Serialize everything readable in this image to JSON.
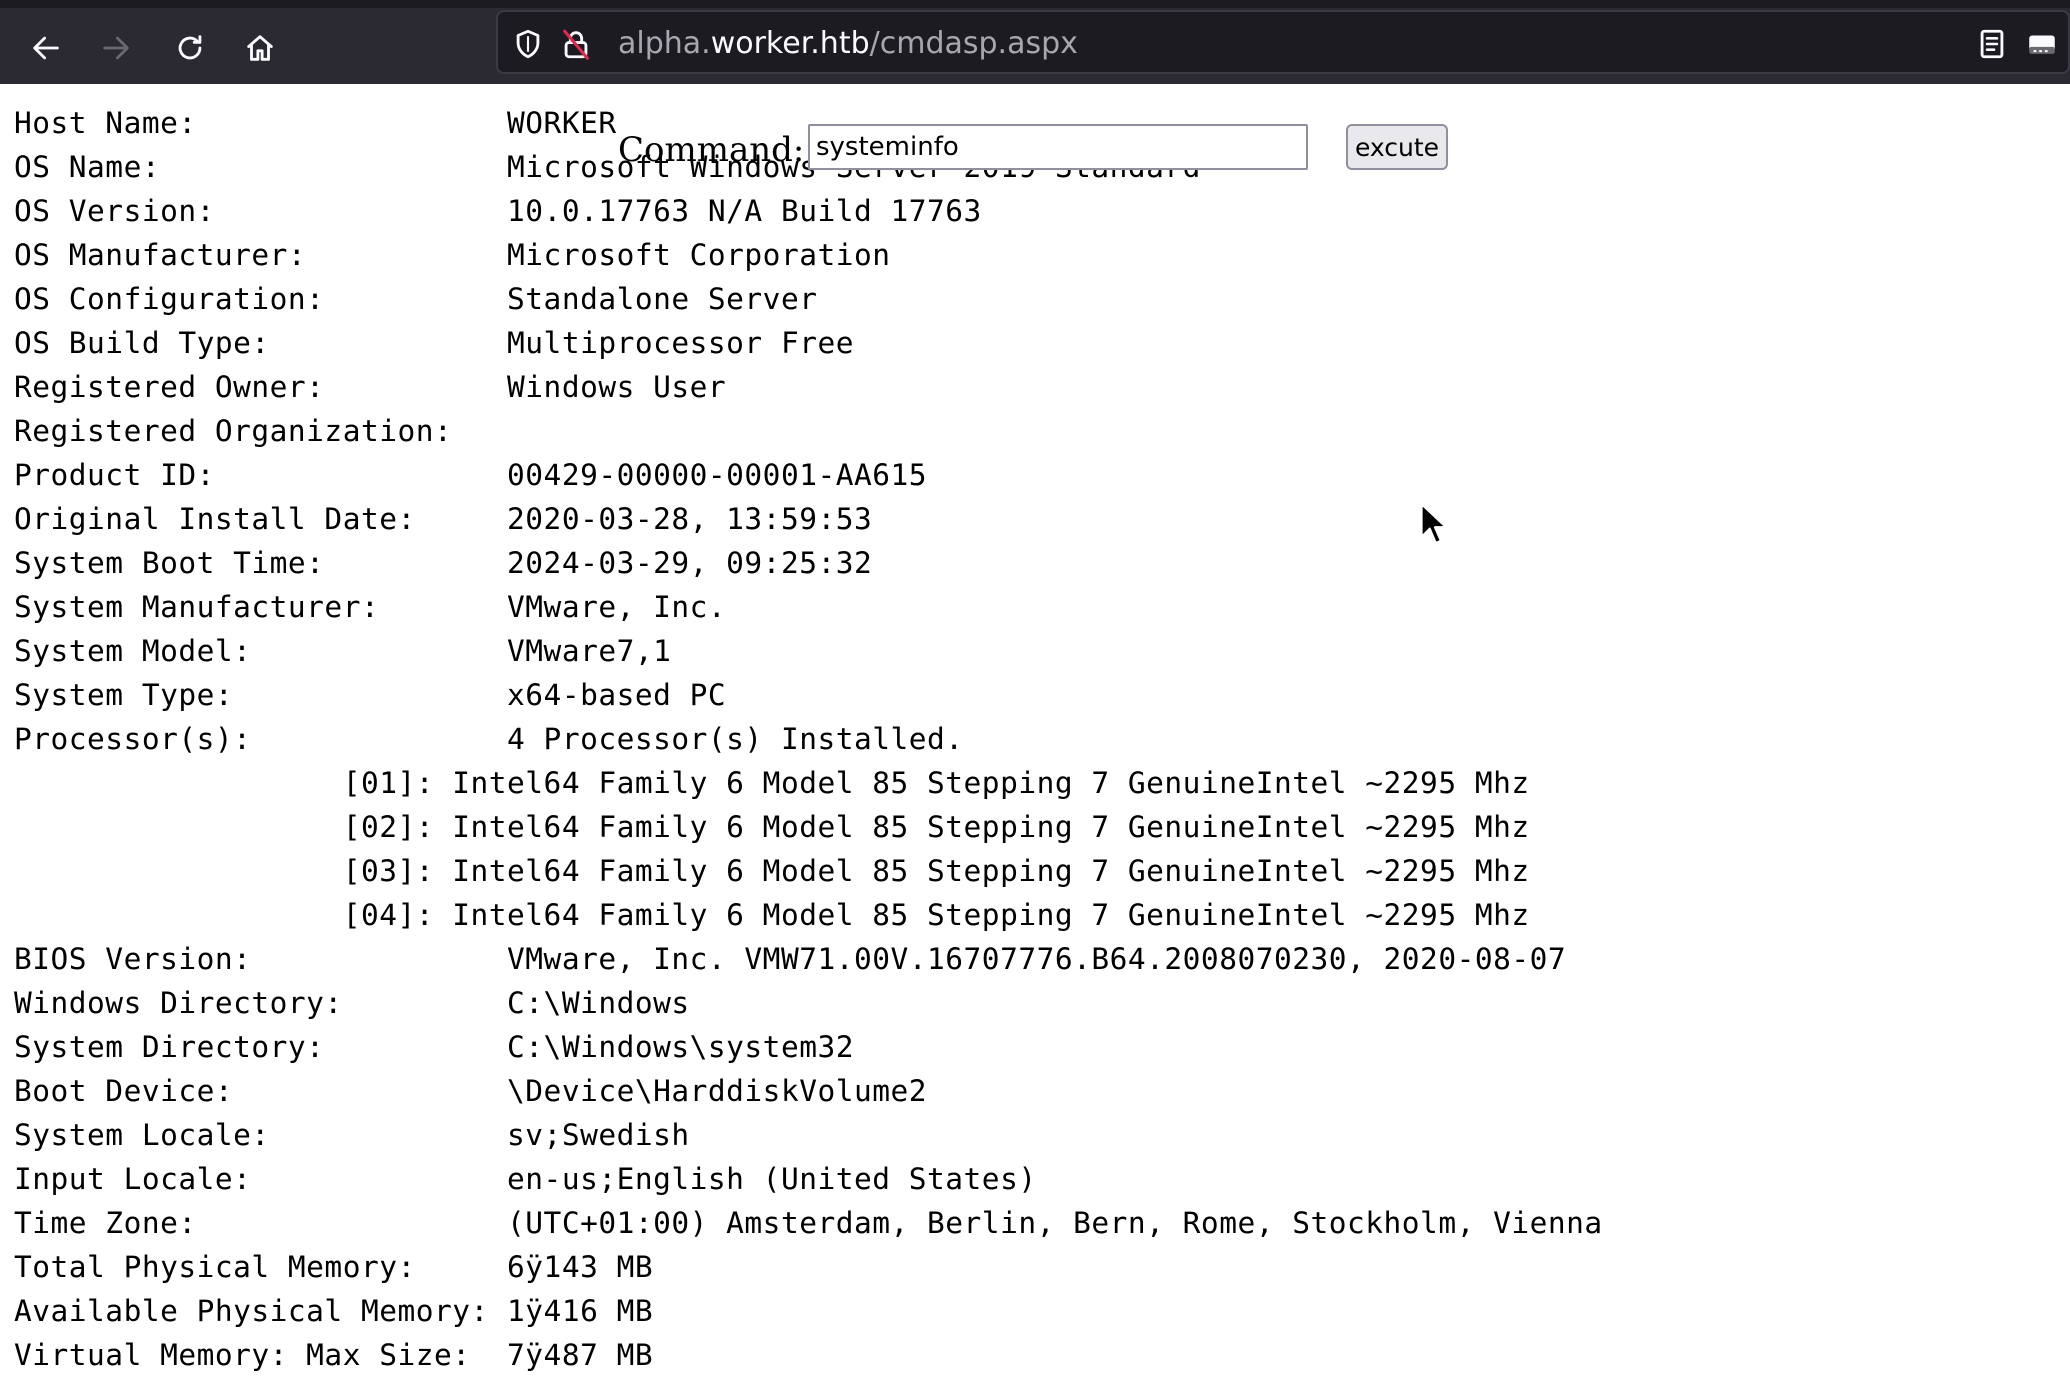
{
  "browser": {
    "url_prefix": "alpha.",
    "url_host": "worker.htb",
    "url_path": "/cmdasp.aspx",
    "icons": {
      "back": "arrow-left-icon",
      "forward": "arrow-right-icon",
      "reload": "reload-icon",
      "home": "home-icon",
      "tracking": "shield-icon",
      "insecure": "insecure-lock-icon",
      "reader": "reader-view-icon",
      "extension": "extension-icon"
    },
    "colors": {
      "toolbar": "#2b2a33",
      "urlbar": "#1c1b22",
      "icon": "#fbfbfe",
      "icon_disabled": "#6a6970",
      "insecure_accent": "#e22850"
    }
  },
  "form": {
    "label": "Command:",
    "input_value": "systeminfo",
    "button_label": "excute"
  },
  "output_lines": [
    "Host Name:                 WORKER",
    "OS Name:                   Microsoft Windows Server 2019 Standard",
    "OS Version:                10.0.17763 N/A Build 17763",
    "OS Manufacturer:           Microsoft Corporation",
    "OS Configuration:          Standalone Server",
    "OS Build Type:             Multiprocessor Free",
    "Registered Owner:          Windows User",
    "Registered Organization:",
    "Product ID:                00429-00000-00001-AA615",
    "Original Install Date:     2020-03-28, 13:59:53",
    "System Boot Time:          2024-03-29, 09:25:32",
    "System Manufacturer:       VMware, Inc.",
    "System Model:              VMware7,1",
    "System Type:               x64-based PC",
    "Processor(s):              4 Processor(s) Installed.",
    "                  [01]: Intel64 Family 6 Model 85 Stepping 7 GenuineIntel ~2295 Mhz",
    "                  [02]: Intel64 Family 6 Model 85 Stepping 7 GenuineIntel ~2295 Mhz",
    "                  [03]: Intel64 Family 6 Model 85 Stepping 7 GenuineIntel ~2295 Mhz",
    "                  [04]: Intel64 Family 6 Model 85 Stepping 7 GenuineIntel ~2295 Mhz",
    "BIOS Version:              VMware, Inc. VMW71.00V.16707776.B64.2008070230, 2020-08-07",
    "Windows Directory:         C:\\Windows",
    "System Directory:          C:\\Windows\\system32",
    "Boot Device:               \\Device\\HarddiskVolume2",
    "System Locale:             sv;Swedish",
    "Input Locale:              en-us;English (United States)",
    "Time Zone:                 (UTC+01:00) Amsterdam, Berlin, Bern, Rome, Stockholm, Vienna",
    "Total Physical Memory:     6ÿ143 MB",
    "Available Physical Memory: 1ÿ416 MB",
    "Virtual Memory: Max Size:  7ÿ487 MB"
  ]
}
